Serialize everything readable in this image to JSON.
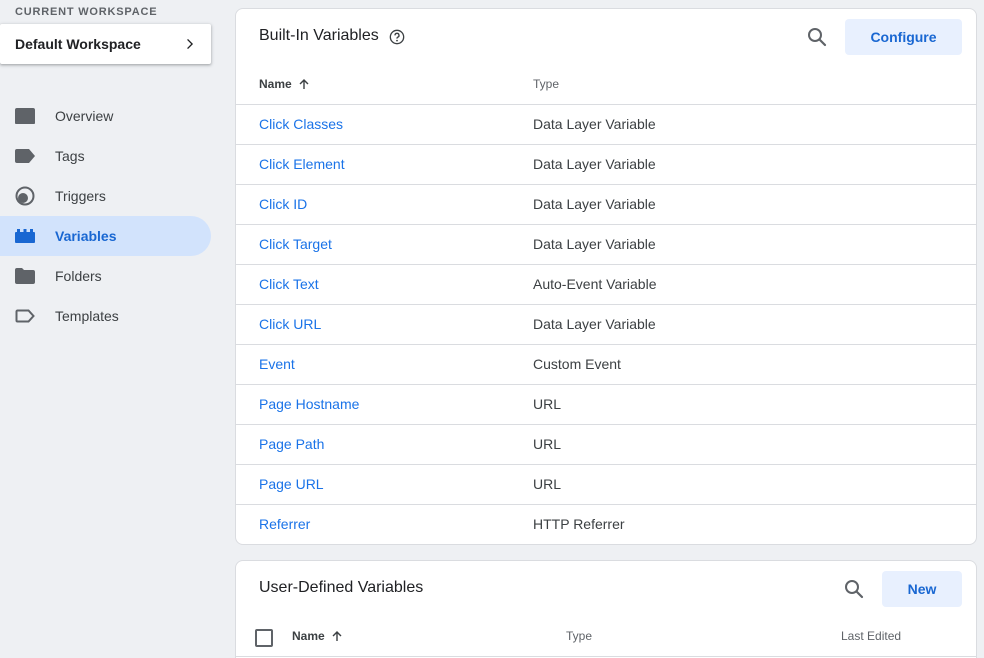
{
  "workspace": {
    "label": "CURRENT WORKSPACE",
    "name": "Default Workspace"
  },
  "nav": {
    "items": [
      {
        "label": "Overview",
        "icon": "overview-icon"
      },
      {
        "label": "Tags",
        "icon": "tag-icon"
      },
      {
        "label": "Triggers",
        "icon": "trigger-icon"
      },
      {
        "label": "Variables",
        "icon": "variables-icon",
        "active": true
      },
      {
        "label": "Folders",
        "icon": "folder-icon"
      },
      {
        "label": "Templates",
        "icon": "template-icon"
      }
    ]
  },
  "builtin": {
    "title": "Built-In Variables",
    "configure_label": "Configure",
    "columns": {
      "name": "Name",
      "type": "Type"
    },
    "rows": [
      {
        "name": "Click Classes",
        "type": "Data Layer Variable"
      },
      {
        "name": "Click Element",
        "type": "Data Layer Variable"
      },
      {
        "name": "Click ID",
        "type": "Data Layer Variable"
      },
      {
        "name": "Click Target",
        "type": "Data Layer Variable"
      },
      {
        "name": "Click Text",
        "type": "Auto-Event Variable"
      },
      {
        "name": "Click URL",
        "type": "Data Layer Variable"
      },
      {
        "name": "Event",
        "type": "Custom Event"
      },
      {
        "name": "Page Hostname",
        "type": "URL"
      },
      {
        "name": "Page Path",
        "type": "URL"
      },
      {
        "name": "Page URL",
        "type": "URL"
      },
      {
        "name": "Referrer",
        "type": "HTTP Referrer"
      }
    ]
  },
  "userdefined": {
    "title": "User-Defined Variables",
    "new_label": "New",
    "columns": {
      "name": "Name",
      "type": "Type",
      "last_edited": "Last Edited"
    }
  },
  "colors": {
    "accent": "#1a73e8",
    "active_bg": "#d2e3fc",
    "button_bg": "#e8f0fe"
  }
}
